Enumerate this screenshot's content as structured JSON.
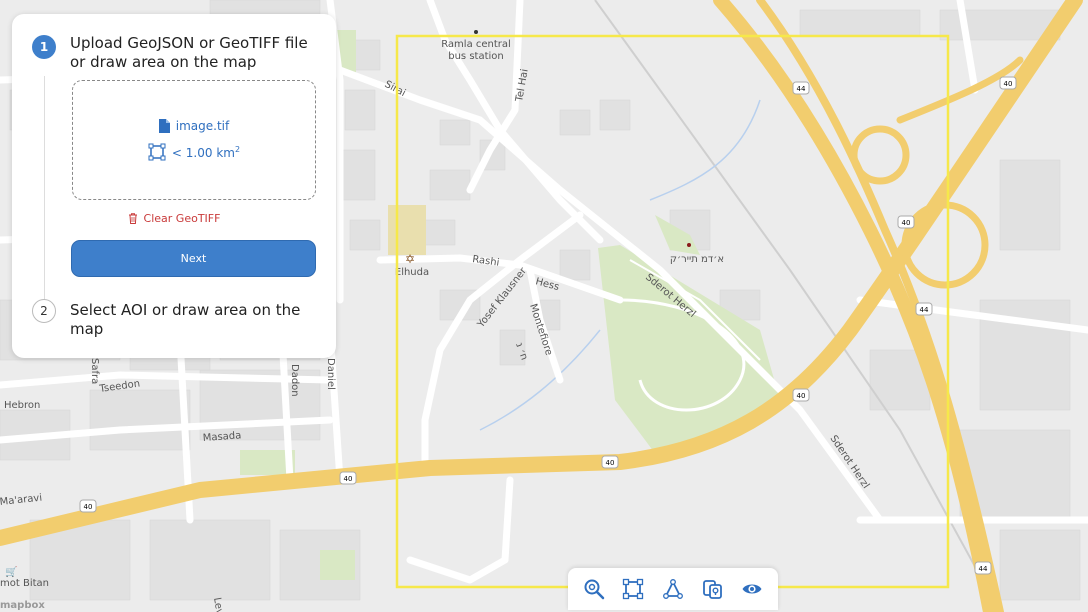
{
  "map": {
    "labels": {
      "ramla_station_1": "Ramla central",
      "ramla_station_2": "bus station",
      "tel_hai": "Tel Hai",
      "sirai": "Sirai",
      "elhuda": "Elhuda",
      "rashi": "Rashi",
      "hess": "Hess",
      "yosef_klausner": "Yosef Klausner",
      "montefiore": "Montefiore",
      "sderot_herzl_1": "Sderot Herzl",
      "sderot_herzl_2": "Sderot Herzl",
      "hebrew_park": "א׳דמ תייר׳ק",
      "hebrew_small": "ח׳ נ",
      "hebron": "Hebron",
      "tseedon": "Tseedon",
      "masada": "Masada",
      "dadon": "Dadon",
      "daniel": "Daniel",
      "safra": "Safra",
      "maaravi": "Ma'aravi",
      "bitan": "mot Bitan",
      "levin": "Levin",
      "road40": "40",
      "road44": "44"
    },
    "colors": {
      "background": "#ececec",
      "road": "#ffffff",
      "highway": "#f2cd6e",
      "park": "#d9e8c4",
      "selection": "#f6e84a"
    },
    "brand": "mapbox"
  },
  "panel": {
    "step1": {
      "number": "1",
      "title_line1": "Upload GeoJSON or GeoTIFF file",
      "title_line2": "or draw area on the map",
      "file_icon": "file-icon",
      "file_name": "image.tif",
      "area_icon": "area-square-icon",
      "area_text": "<  1.00 km",
      "area_unit_sup": "2",
      "clear_icon": "trash-icon",
      "clear_label": "Clear GeoTIFF",
      "next_label": "Next"
    },
    "step2": {
      "number": "2",
      "title_line1": "Select AOI or draw area on the",
      "title_line2": "map"
    }
  },
  "toolbar": {
    "tools": [
      "zoom-icon",
      "draw-rectangle-icon",
      "draw-polygon-icon",
      "upload-file-icon",
      "visibility-icon"
    ]
  }
}
